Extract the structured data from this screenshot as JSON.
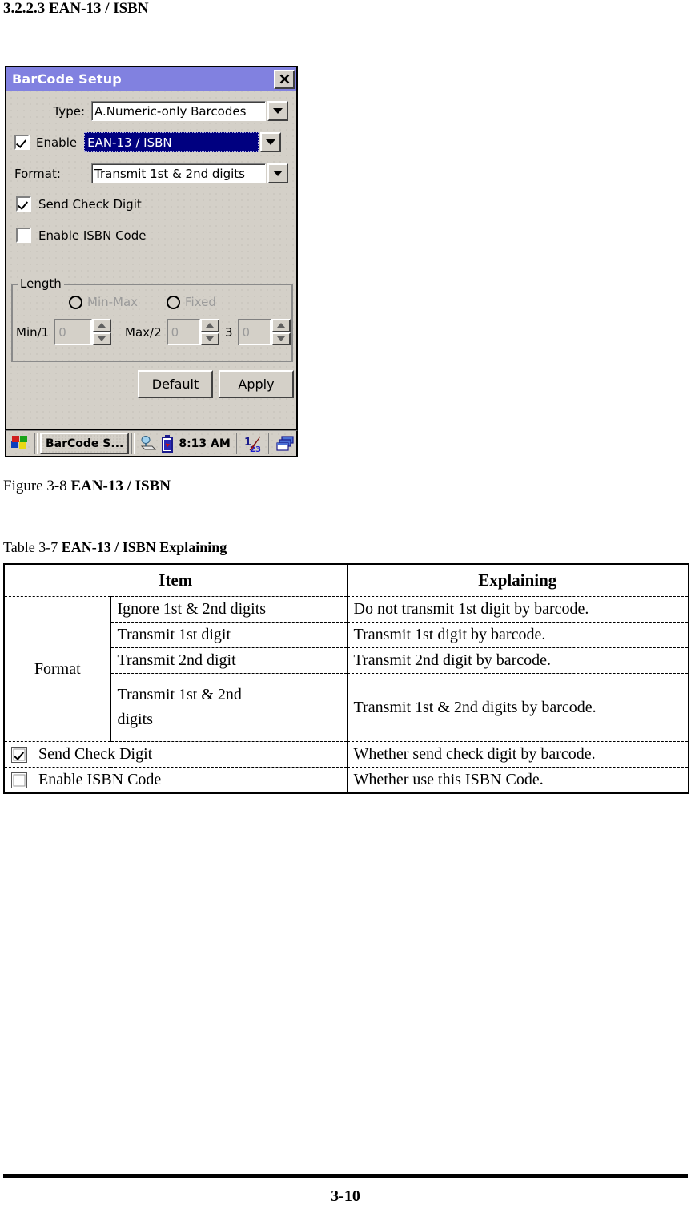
{
  "document": {
    "heading": "3.2.2.3 EAN-13 / ISBN",
    "figure_caption_prefix": "Figure 3-8 ",
    "figure_caption_bold": "EAN-13 / ISBN",
    "table_caption_prefix": "Table 3-7 ",
    "table_caption_bold": "EAN-13 / ISBN Explaining",
    "page_number": "3-10"
  },
  "dialog": {
    "title": "BarCode Setup",
    "close_label": "close-icon",
    "type_label": "Type:",
    "type_value": "A.Numeric-only Barcodes",
    "enable_label": "Enable",
    "enable_checked": true,
    "enable_value": "EAN-13 / ISBN",
    "format_label": "Format:",
    "format_value": "Transmit 1st & 2nd digits",
    "send_check_digit_label": "Send Check Digit",
    "send_check_digit_checked": true,
    "enable_isbn_label": "Enable ISBN Code",
    "enable_isbn_checked": false,
    "length": {
      "group_title": "Length",
      "radio_minmax": "Min-Max",
      "radio_fixed": "Fixed",
      "min_label": "Min/1",
      "min_value": "0",
      "max_label": "Max/2",
      "max_value": "0",
      "third_label": "3",
      "third_value": "0"
    },
    "default_button": "Default",
    "apply_button": "Apply"
  },
  "taskbar": {
    "start_label": "start-icon",
    "task_button": "BarCode S...",
    "clock": "8:13 AM"
  },
  "table": {
    "headers": [
      "Item",
      "Explaining"
    ],
    "format_group_label": "Format",
    "format_rows": [
      {
        "item": "Ignore 1st & 2nd digits",
        "explaining": "Do not transmit 1st digit by barcode.",
        "bold": false
      },
      {
        "item": "Transmit 1st digit",
        "explaining": "Transmit 1st digit by barcode.",
        "bold": false
      },
      {
        "item": "Transmit 2nd digit",
        "explaining": "Transmit 2nd digit by barcode.",
        "bold": false
      },
      {
        "item": "Transmit 1st & 2nd digits",
        "explaining": "Transmit 1st & 2nd digits by barcode.",
        "bold": true
      }
    ],
    "checkbox_rows": [
      {
        "item": "Send Check Digit",
        "explaining": "Whether send check digit by barcode.",
        "checked": true
      },
      {
        "item": "Enable ISBN Code",
        "explaining": "Whether use this ISBN Code.",
        "checked": false
      }
    ]
  }
}
